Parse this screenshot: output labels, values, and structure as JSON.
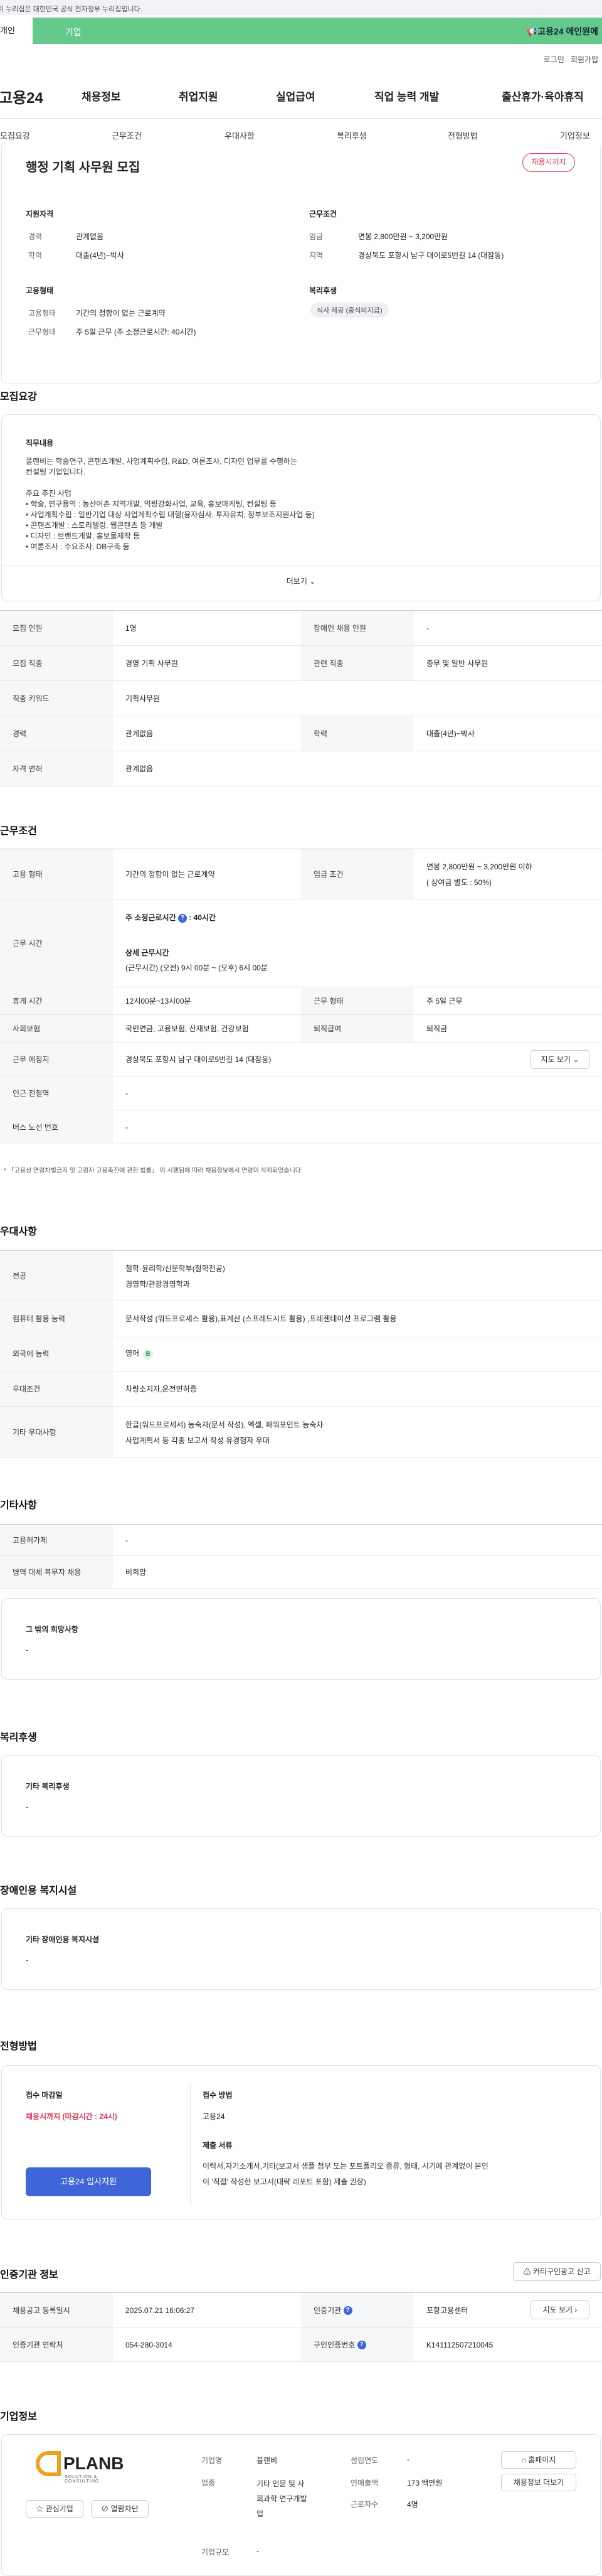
{
  "gov_notice": "이 누리집은 대한민국 공식 전자정부 누리집입니다.",
  "topbar": {
    "left": "개인",
    "center": "기업",
    "right": "고용24 에인원에"
  },
  "util": {
    "login": "로그인",
    "join": "회원가입"
  },
  "logo": "고용24",
  "gnb": [
    "채용정보",
    "취업지원",
    "실업급여",
    "직업 능력 개발",
    "출산휴가·육아휴직"
  ],
  "tabs": [
    "모집요강",
    "근무조건",
    "우대사항",
    "복리후생",
    "전형방법",
    "기업정보"
  ],
  "summary": {
    "title": "행정 기획 사무원 모집",
    "badge": "채용시까지",
    "qual_title": "지원자격",
    "qual": [
      [
        "경력",
        "관계없음"
      ],
      [
        "학력",
        "대졸(4년)~박사"
      ]
    ],
    "cond_title": "근무조건",
    "cond": [
      [
        "임금",
        "연봉 2,800만원 ~ 3,200만원"
      ],
      [
        "지역",
        "경상북도 포항시 남구 대이로5번길 14 (대잠동)"
      ]
    ],
    "emp_title": "고용형태",
    "emp": [
      [
        "고용형태",
        "기간의 정함이 없는 근로계약"
      ],
      [
        "근무형태",
        "주 5일 근무 (주 소정근로시간: 40시간)"
      ]
    ],
    "welfare_title": "복리후생",
    "welfare_chip": "식사 제공 (중식비지급)"
  },
  "recruit": {
    "title": "모집요강",
    "job_title": "직무내용",
    "job_lines": [
      "플랜비는 학술연구, 콘텐츠개발, 사업계획수립, R&D, 여론조사, 디자인 업무를 수행하는",
      "컨설팅 기업입니다.",
      "",
      "주요 추진 사업",
      "• 학술, 연구용역 : 농산어촌 지역개발, 역량강화사업, 교육, 홍보마케팅, 컨설팅 등",
      "• 사업계획수립 : 일반기업 대상 사업계획수립 대행(융자심사, 투자유치, 정부보조지원사업 등)",
      "• 콘텐츠개발 : 스토리텔링, 웹콘텐츠 등 개발",
      "• 디자인 : 브랜드개발, 홍보물제작 등",
      "• 여론조사 : 수요조사, DB구축 등"
    ],
    "more": "더보기",
    "rows": [
      {
        "k1": "모집 인원",
        "v1": "1명",
        "k2": "장애인 채용 인원",
        "v2": "-"
      },
      {
        "k1": "모집 직종",
        "v1": "경영 기획 사무원",
        "k2": "관련 직종",
        "v2": "총무 및 일반 사무원"
      },
      {
        "k1": "직종 키워드",
        "v1": "기획사무원",
        "k2": "",
        "v2": ""
      },
      {
        "k1": "경력",
        "v1": "관계없음",
        "k2": "학력",
        "v2": "대졸(4년)~박사"
      },
      {
        "k1": "자격 면허",
        "v1": "관계없음",
        "k2": "",
        "v2": ""
      }
    ]
  },
  "work": {
    "title": "근무조건",
    "emp_k": "고용 형태",
    "emp_v": "기간의 정함이 없는 근로계약",
    "pay_k": "임금 조건",
    "pay_v1": "연봉 2,800만원 ~ 3,200만원 이하",
    "pay_v2": "( 상여금 별도 : 50%)",
    "time_k": "근무 시간",
    "time_l1": "주 소정근로시간",
    "time_l1b": "40시간",
    "time_l2": "상세 근무시간",
    "time_l3": "(근무시간) (오전) 9시 00분 ~ (오후) 6시 00분",
    "rows": [
      {
        "k1": "휴게 시간",
        "v1": "12시00분~13시00분",
        "k2": "근무 형태",
        "v2": "주 5일 근무"
      },
      {
        "k1": "사회보험",
        "v1": "국민연금, 고용보험, 산재보험, 건강보험",
        "k2": "퇴직급여",
        "v2": "퇴직금"
      }
    ],
    "addr_k": "근무 예정지",
    "addr_v": "경상북도 포항시 남구 대이로5번길 14 (대잠동)",
    "map_btn": "지도 보기",
    "subway_k": "인근 전철역",
    "subway_v": "-",
    "bus_k": "버스 노선 번호",
    "bus_v": "-",
    "note": "* 「고용상 연령차별금지 및 고령자 고용촉진에 관한 법률」 이 시행됨에 따라 채용정보에서 연령이 삭제되었습니다."
  },
  "pref": {
    "title": "우대사항",
    "rows": [
      {
        "k": "전공",
        "v": [
          "철학·윤리학/신문학부(철학전공)",
          "경영학/관광경영학과"
        ]
      },
      {
        "k": "컴퓨터 활용 능력",
        "v": [
          "문서작성 (워드프로세스 활용),표계산 (스프레드시트 활용) ,프레젠테이션 프로그램 활용"
        ]
      },
      {
        "k": "외국어 능력",
        "v": [
          "영어"
        ]
      },
      {
        "k": "우대조건",
        "v": [
          "차량소지자,운전면허증"
        ]
      },
      {
        "k": "기타 우대사항",
        "v": [
          "한글(워드프로세서) 능숙자(문서 작성), 엑셀, 파워포인트 능숙자",
          "사업계획서 등 각종 보고서 작성 유경험자 우대"
        ]
      }
    ],
    "lang_badge": "B"
  },
  "etc": {
    "title": "기타사항",
    "rows": [
      {
        "k": "고용허가제",
        "v": "-"
      },
      {
        "k": "병역 대체 복무자 채용",
        "v": "비희망"
      }
    ],
    "box_title": "그 밖의 희망사항",
    "box_v": "-"
  },
  "welfare": {
    "title": "복리후생",
    "box_title": "기타 복리후생",
    "box_v": "-"
  },
  "disabled": {
    "title": "장애인용 복지시설",
    "box_title": "기타 장애인용 복지시설",
    "box_v": "-"
  },
  "process": {
    "title": "전형방법",
    "deadline_k": "접수 마감일",
    "deadline_v": "채용시까지 (마감시간 : 24시)",
    "apply_btn": "고용24 입사지원",
    "method_k": "접수 방법",
    "method_v": "고용24",
    "docs_k": "제출 서류",
    "docs_v": [
      "이력서,자기소개서,기타(보고서 샘플 첨부 또는 포트폴리오  종류, 형태, 시기에 관계없이 본인",
      "이 '직접' 작성한 보고서(대략 레포트 포함) 제출 권장)"
    ]
  },
  "cert": {
    "title": "인증기관 정보",
    "inquiry_btn": "커티구인광고 신고",
    "r1": {
      "k1": "채용공고 등록일시",
      "v1": "2025.07.21 16:06:27",
      "k2": "인증기관",
      "v2": "포항고용센터",
      "btn": "지도 보기"
    },
    "r2": {
      "k1": "인증기관 연락처",
      "v1": "054-280-3014",
      "k2": "구인인증번호",
      "v2": "K141112507210045"
    }
  },
  "company": {
    "title": "기업정보",
    "logo_main": "PLANB",
    "logo_sub": "SOLUTION & CONSULTING",
    "btn_fav": "관심기업",
    "btn_block": "열람차단",
    "name_k": "기업명",
    "name_v": "플랜비",
    "biz_k": "업종",
    "biz_v": [
      "기타 인문 및 사",
      "회과학 연구개발",
      "업"
    ],
    "scale_k": "기업규모",
    "scale_v": "-",
    "year_k": "설립연도",
    "year_v": "-",
    "sales_k": "연매출액",
    "sales_v": "173 백만원",
    "staff_k": "근로자수",
    "staff_v": "4명",
    "home_btn": "홈페이지",
    "list_btn": "채용정보 더보기"
  }
}
